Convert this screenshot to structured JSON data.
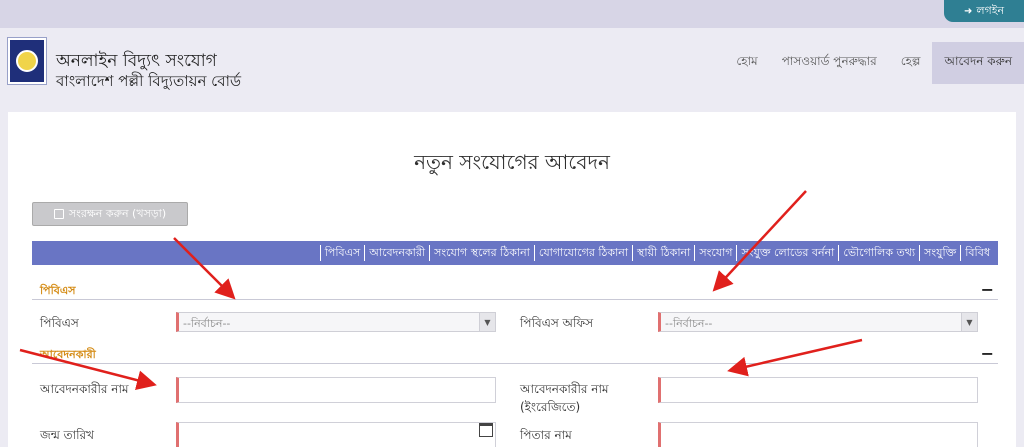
{
  "topbar": {
    "login_label": "লগইন",
    "login_icon": "sign-in-icon"
  },
  "brand": {
    "title": "অনলাইন বিদ্যুৎ সংযোগ",
    "subtitle": "বাংলাদেশ পল্লী বিদ্যুতায়ন বোর্ড"
  },
  "nav": {
    "items": [
      {
        "label": "হোম"
      },
      {
        "label": "পাসওয়ার্ড পুনরুদ্ধার"
      },
      {
        "label": "হেল্প"
      },
      {
        "label": "আবেদন করুন"
      }
    ]
  },
  "page": {
    "title": "নতুন সংযোগের আবেদন"
  },
  "toolbar": {
    "save_label": "সংরক্ষন করুন (খসড়া)",
    "save_icon": "floppy-disk-icon"
  },
  "tabs": [
    {
      "label": "পিবিএস"
    },
    {
      "label": "আবেদনকারী"
    },
    {
      "label": "সংযোগ স্থলের ঠিকানা"
    },
    {
      "label": "যোগাযোগের ঠিকানা"
    },
    {
      "label": "স্থায়ী ঠিকানা"
    },
    {
      "label": "সংযোগ"
    },
    {
      "label": "সংযুক্ত লোডের বর্ননা"
    },
    {
      "label": "ভৌগোলিক তথ্য"
    },
    {
      "label": "সংযুক্তি"
    },
    {
      "label": "বিবিধ"
    }
  ],
  "sections": {
    "pbs": {
      "title": "পিবিএস",
      "toggle": "−",
      "pbs_label": "পিবিএস",
      "pbs_value": "--নির্বাচন--",
      "office_label": "পিবিএস অফিস",
      "office_value": "--নির্বাচন--"
    },
    "applicant": {
      "title": "আবেদনকারী",
      "toggle": "−",
      "name_label": "আবেদনকারীর নাম",
      "name_en_label_1": "আবেদনকারীর নাম",
      "name_en_label_2": "(ইংরেজিতে)",
      "dob_label": "জন্ম তারিখ",
      "father_label": "পিতার নাম"
    }
  },
  "colors": {
    "tab_strip": "#6975c4",
    "section_title": "#d48a12",
    "required_marker": "#e07070",
    "login_button": "#2f7f93",
    "annotation_arrow": "#e0201c"
  }
}
